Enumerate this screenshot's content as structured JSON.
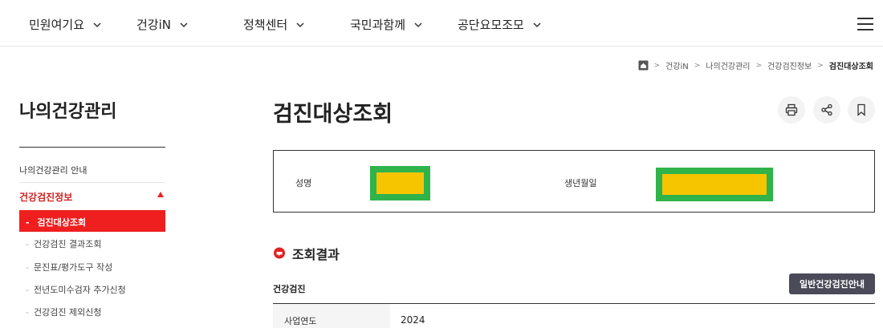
{
  "nav": {
    "items": [
      {
        "label": "민원여기요"
      },
      {
        "label": "건강iN"
      },
      {
        "label": "정책센터"
      },
      {
        "label": "국민과함께"
      },
      {
        "label": "공단요모조모"
      }
    ]
  },
  "breadcrumb": {
    "items": [
      "건강iN",
      "나의건강관리",
      "건강검진정보",
      "검진대상조회"
    ]
  },
  "sidebar": {
    "title": "나의건강관리",
    "guide_link": "나의건강관리 안내",
    "section": "건강검진정보",
    "active": "검진대상조회",
    "sub_items": [
      "건강검진 결과조회",
      "문진표/평가도구 작성",
      "전년도미수검자 추가신청",
      "건강검진 제외신청"
    ],
    "bullet": "-"
  },
  "main": {
    "title": "검진대상조회",
    "info": {
      "name_label": "성명",
      "birth_label": "생년월일"
    },
    "result_heading": "조회결과",
    "section_label": "건강검진",
    "guide_button": "일반건강검진안내",
    "table": {
      "row_label": "사업연도",
      "row_value": "2024"
    }
  },
  "colors": {
    "accent": "#ef1f1f",
    "redaction_border": "#2fb34a",
    "redaction_fill": "#f7c400",
    "dark_button": "#4a4a58"
  },
  "icons": [
    "chevron-down-icon",
    "menu-icon",
    "home-icon",
    "print-icon",
    "share-icon",
    "bookmark-icon",
    "pin-icon"
  ]
}
